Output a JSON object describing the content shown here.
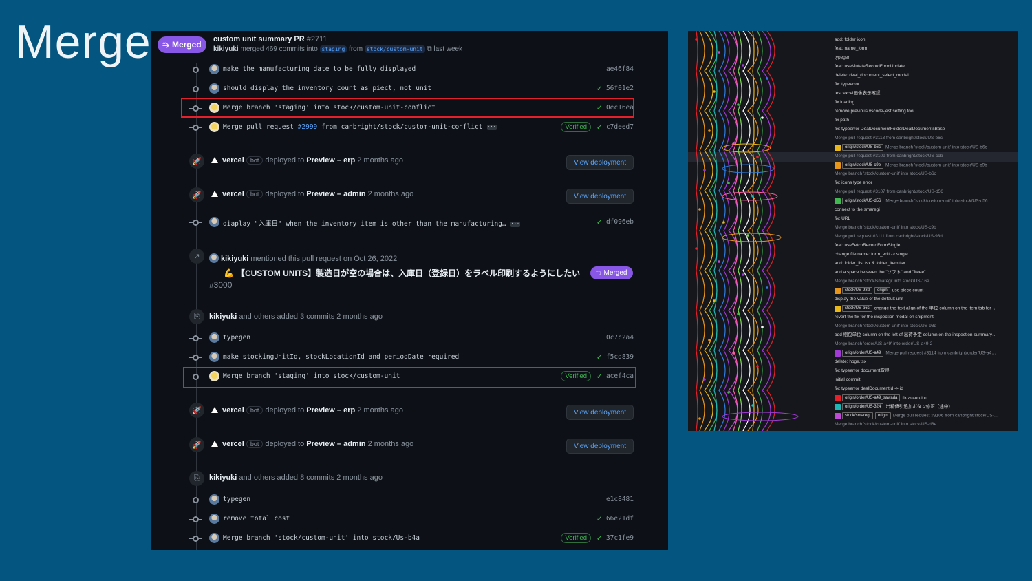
{
  "slide": {
    "title": "Merge"
  },
  "pr": {
    "status": "Merged",
    "title": "custom unit summary PR",
    "number": "#2711",
    "author": "kikiyuki",
    "merged_text": "merged 469 commits into",
    "base": "staging",
    "from": "from",
    "head": "stock/custom-unit",
    "time": "last week"
  },
  "commits_top": [
    {
      "msg": "make the manufacturing date to be fully displayed",
      "sha": "ae46f84",
      "check": false,
      "verified": false
    },
    {
      "msg": "should display the inventory count as piect, not unit",
      "sha": "56f01e2",
      "check": true,
      "verified": false
    },
    {
      "msg": "Merge branch 'staging' into stock/custom-unit-conflict",
      "sha": "0ec16ea",
      "check": true,
      "verified": false
    },
    {
      "msg_pre": "Merge pull request ",
      "msg_link": "#2999",
      "msg_post": " from canbright/stock/custom-unit-conflict",
      "sha": "c7deed7",
      "check": true,
      "verified": true
    }
  ],
  "deploy1": {
    "actor": "vercel",
    "bot": "bot",
    "text": "deployed to",
    "target": "Preview – erp",
    "time": "2 months ago",
    "button": "View deployment"
  },
  "deploy2": {
    "actor": "vercel",
    "bot": "bot",
    "text": "deployed to",
    "target": "Preview – admin",
    "time": "2 months ago",
    "button": "View deployment"
  },
  "commit_mid": {
    "msg": "diaplay \"入庫日\" when the inventory item is other than the manufacturing…",
    "sha": "df096eb"
  },
  "mention": {
    "actor": "kikiyuki",
    "text": "mentioned this pull request on Oct 26, 2022",
    "ref_title": "【CUSTOM UNITS】製造日が空の場合は、入庫日（登録日）をラベル印刷するようにしたい",
    "ref_num": "#3000",
    "ref_status": "Merged"
  },
  "added1": {
    "actor": "kikiyuki",
    "text": "and others added 3 commits 2 months ago"
  },
  "commits_mid": [
    {
      "msg": "typegen",
      "sha": "0c7c2a4",
      "check": false,
      "verified": false
    },
    {
      "msg": "make stockingUnitId, stockLocationId and periodDate required",
      "sha": "f5cd839",
      "check": true,
      "verified": false
    },
    {
      "msg": "Merge branch 'staging' into stock/custom-unit",
      "sha": "acef4ca",
      "check": true,
      "verified": true
    }
  ],
  "deploy3": {
    "actor": "vercel",
    "bot": "bot",
    "text": "deployed to",
    "target": "Preview – erp",
    "time": "2 months ago",
    "button": "View deployment"
  },
  "deploy4": {
    "actor": "vercel",
    "bot": "bot",
    "text": "deployed to",
    "target": "Preview – admin",
    "time": "2 months ago",
    "button": "View deployment"
  },
  "added2": {
    "actor": "kikiyuki",
    "text": "and others added 8 commits 2 months ago"
  },
  "commits_bottom": [
    {
      "msg": "typegen",
      "sha": "e1c8481",
      "check": false,
      "verified": false
    },
    {
      "msg": "remove total cost",
      "sha": "66e21df",
      "check": true,
      "verified": false
    },
    {
      "msg": "Merge branch 'stock/custom-unit' into stock/Us-b4a",
      "sha": "37c1fe9",
      "check": true,
      "verified": true
    }
  ],
  "verified_label": "Verified",
  "graph": {
    "lines": [
      {
        "text": "add: folder icon",
        "dim": false
      },
      {
        "text": "feat: name_form",
        "dim": false
      },
      {
        "text": "typegen",
        "dim": false
      },
      {
        "text": "feat: useMutateRecordFormUpdate",
        "dim": false
      },
      {
        "text": "delete: deal_document_select_modal",
        "dim": false
      },
      {
        "text": "fix: typeerror",
        "dim": false
      },
      {
        "text": "test:excel画像表示確認",
        "dim": false
      },
      {
        "text": "fix loading",
        "dim": false
      },
      {
        "text": "remove previous vscode-jest setting tool",
        "dim": false
      },
      {
        "text": "fix path",
        "dim": false
      },
      {
        "text": "fix: typeerror DealDocumentFolderDealDocumentsBase",
        "dim": false
      },
      {
        "text": "Merge pull request #3113 from canbright/stock/US-b6c",
        "dim": true
      },
      {
        "tag": "origin/stock/US-b6c",
        "tagcolor": "#e8b71a",
        "text": "Merge branch 'stock/custom-unit' into stock/US-b6c",
        "dim": true
      },
      {
        "text": "Merge pull request #3109 from canbright/stock/US-c9b",
        "dim": true
      },
      {
        "tag": "origin/stock/US-c9b",
        "tagcolor": "#e8961a",
        "text": "Merge branch 'stock/custom-unit' into stock/US-c9b",
        "dim": true
      },
      {
        "text": "Merge branch 'stock/custom-unit' into stock/US-b6c",
        "dim": true
      },
      {
        "text": "fix: icons type error",
        "dim": false
      },
      {
        "text": "Merge pull request #3107 from canbright/stock/US-d56",
        "dim": true
      },
      {
        "tag": "origin/stock/US-d56",
        "tagcolor": "#3fb950",
        "text": "Merge branch 'stock/custom-unit' into stock/US-d56",
        "dim": true
      },
      {
        "text": "connect to the smaregi",
        "dim": false
      },
      {
        "text": "fix: URL",
        "dim": false
      },
      {
        "text": "Merge branch 'stock/custom-unit' into stock/US-c9b",
        "dim": true
      },
      {
        "text": "Merge pull request #3111 from canbright/stock/US-93d",
        "dim": true
      },
      {
        "text": "feat: useFetchRecordFormSingle",
        "dim": false
      },
      {
        "text": "change file name: form_edit -> single",
        "dim": false
      },
      {
        "text": "add: folder_list.tsx & folder_item.tsx",
        "dim": false
      },
      {
        "text": "add a space between the \"ソフト\" and \"freee\"",
        "dim": false
      },
      {
        "text": "Merge branch 'stock/smaregi' into stock/US-16e",
        "dim": true
      },
      {
        "tag": "stock/US-93d",
        "tag2": "origin",
        "tagcolor": "#e8961a",
        "text": "use piece count",
        "dim": false
      },
      {
        "text": "display the value of the default unit",
        "dim": false
      },
      {
        "tag": "stock/US-b6c",
        "tagcolor": "#e8b71a",
        "text": "change the text align of the 単位 column on the item tab for …",
        "dim": false
      },
      {
        "text": "revert the fix for the inspection modal on shipment",
        "dim": false
      },
      {
        "text": "Merge branch 'stock/custom-unit' into stock/US-93d",
        "dim": true
      },
      {
        "text": "add 梱包単位 column on the left of 出荷予定 column on the inspection summary…",
        "dim": false
      },
      {
        "text": "Merge branch 'order/US-a49' into order/US-a49-2",
        "dim": true
      },
      {
        "tag": "origin/order/US-a49",
        "tagcolor": "#a23ad8",
        "text": "Merge pull request #3114 from canbright/order/US-a4…",
        "dim": true
      },
      {
        "text": "delete: hoge.tsx",
        "dim": false
      },
      {
        "text": "fix: typeerror document取得",
        "dim": false
      },
      {
        "text": "initial commit",
        "dim": false
      },
      {
        "text": "fix: typeerror dealDocumentId -> id",
        "dim": false
      },
      {
        "tag": "origin/order/US-a49_sawada",
        "tagcolor": "#e5202a",
        "text": "fix accordion",
        "dim": false
      },
      {
        "tag": "origin/order/US-324",
        "tagcolor": "#1fb6b6",
        "text": "出精値引追加ボタン修正（途中）",
        "dim": false
      },
      {
        "tag": "stock/smaregi",
        "tag2": "origin",
        "tagcolor": "#c04ad8",
        "text": "Merge pull request #3106 from canbright/stock/US-…",
        "dim": true
      },
      {
        "text": "Merge branch 'stock/custom-unit' into stock/US-d8e",
        "dim": true
      }
    ]
  },
  "colors": {
    "bg": "#045580",
    "gh_bg": "#0d1117",
    "merged": "#8957e5",
    "highlight": "#e5202a",
    "link": "#58a6ff",
    "green": "#3fb950"
  }
}
